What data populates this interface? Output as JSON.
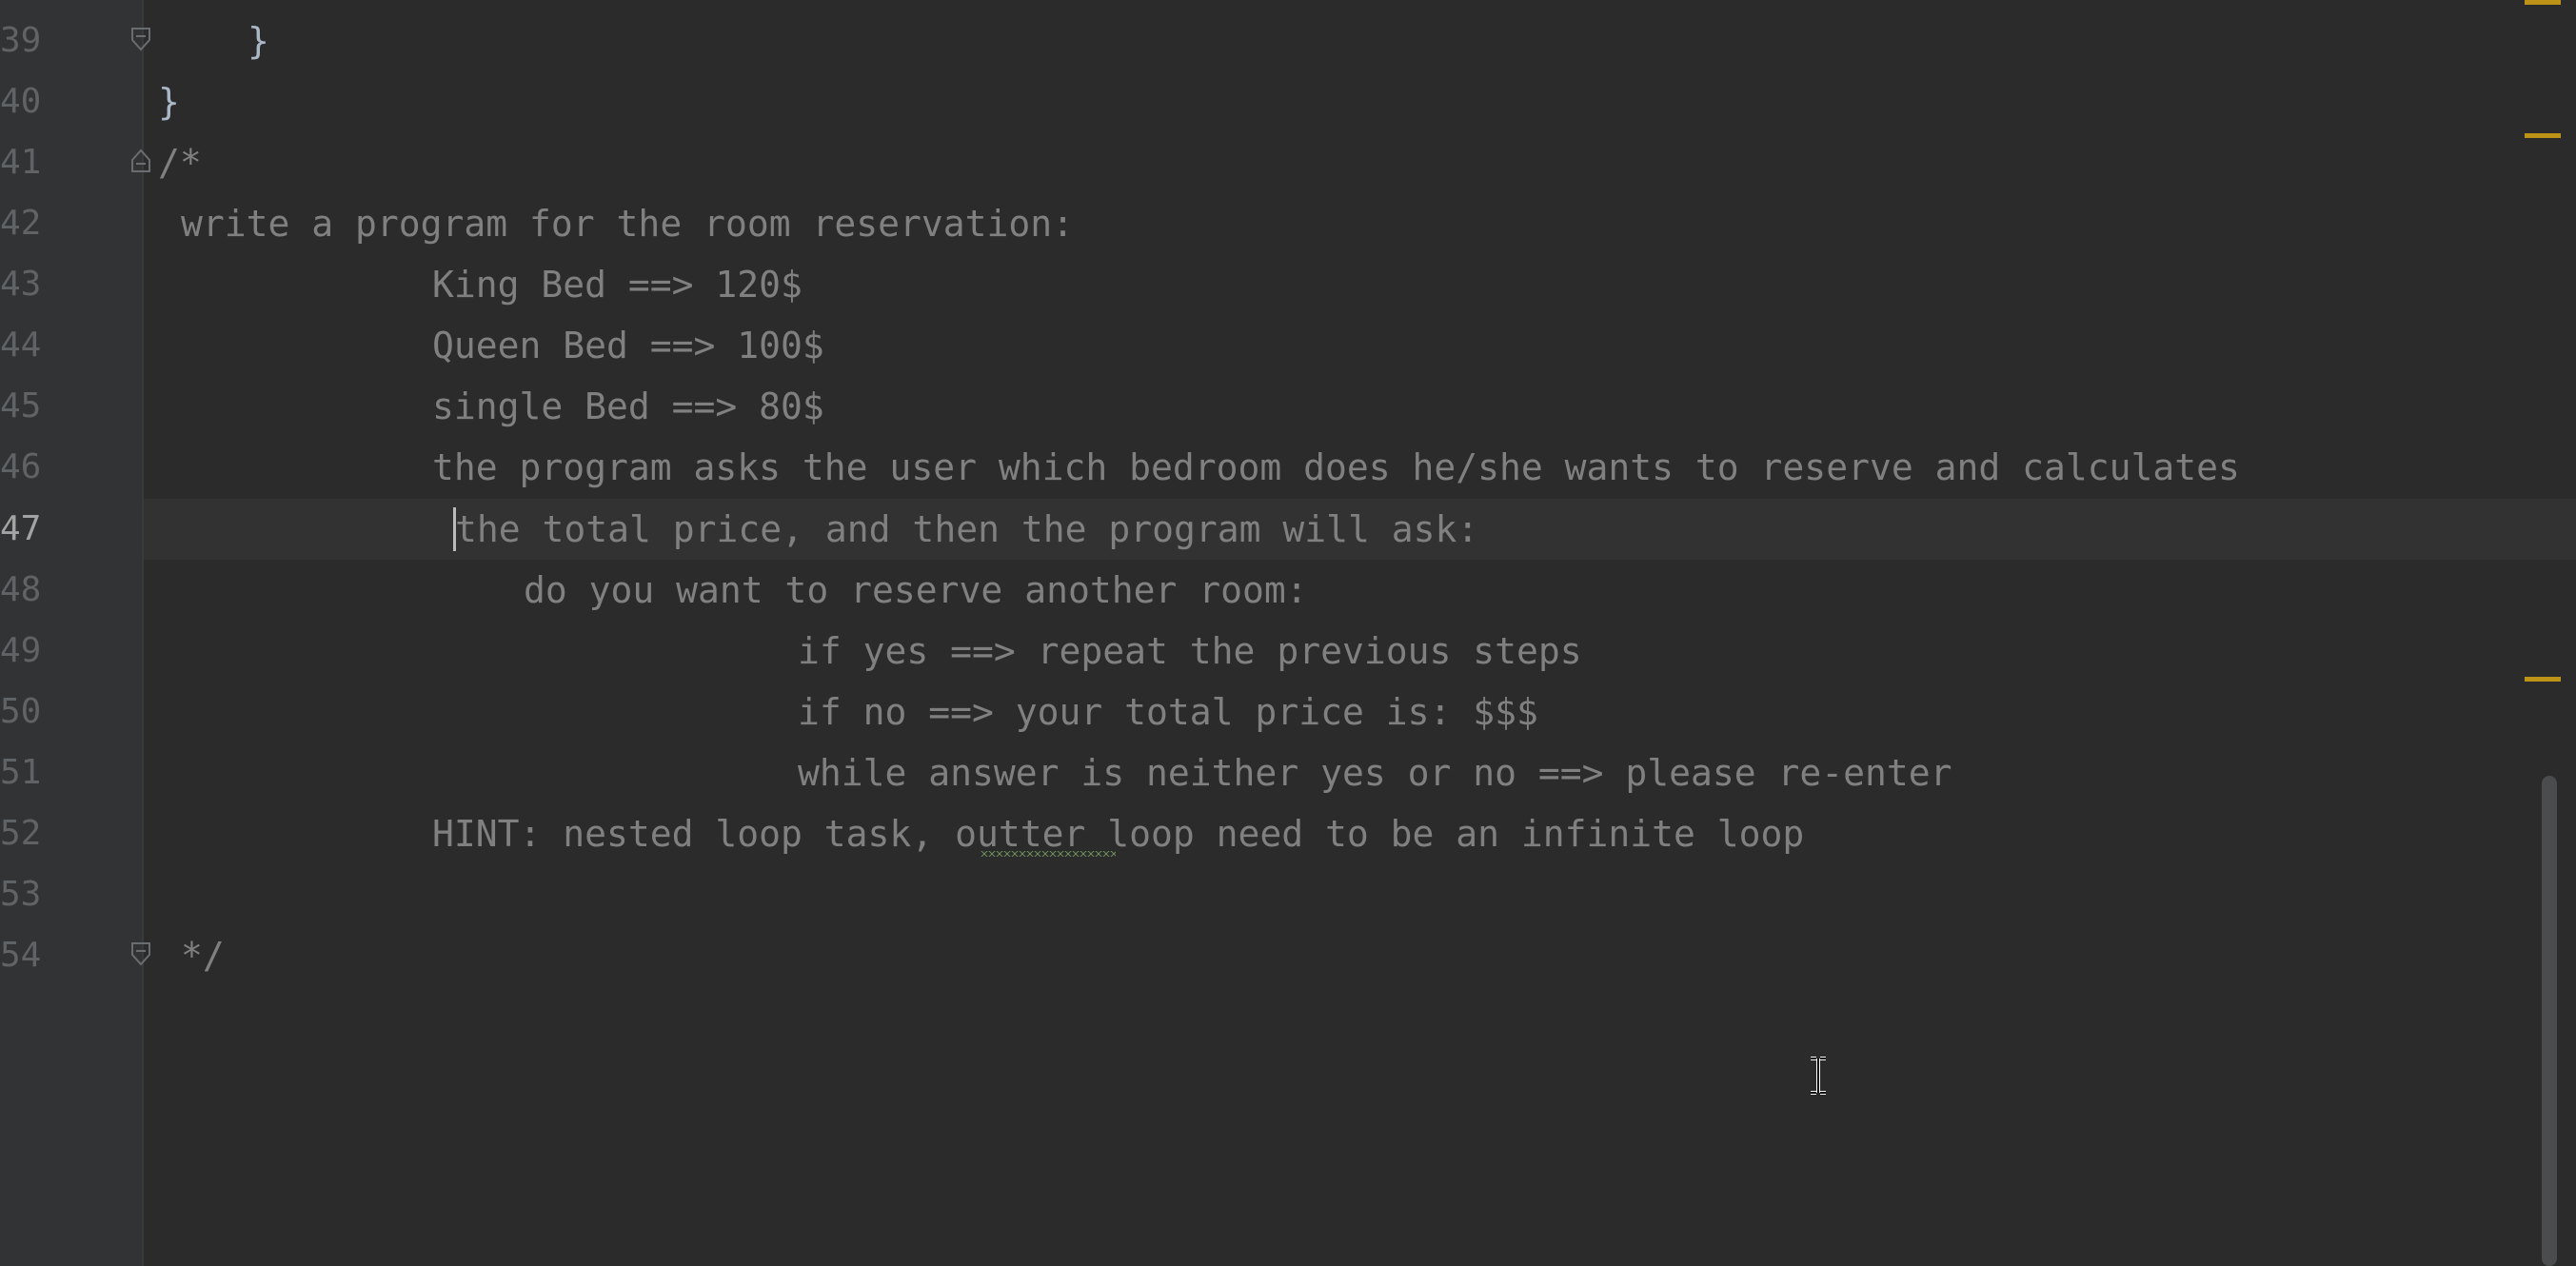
{
  "editor": {
    "current_line": "47",
    "lines": [
      {
        "num": "39",
        "text": "}"
      },
      {
        "num": "40",
        "text": "}"
      },
      {
        "num": "41",
        "text": "/*"
      },
      {
        "num": "42",
        "text": "write a program for the room reservation:"
      },
      {
        "num": "43",
        "text": "King Bed ==> 120$"
      },
      {
        "num": "44",
        "text": "Queen Bed ==> 100$"
      },
      {
        "num": "45",
        "text": "single Bed ==> 80$"
      },
      {
        "num": "46",
        "text": "the program asks the user which bedroom does he/she wants to reserve and calculates"
      },
      {
        "num": "47",
        "text": "the total price, and then the program will ask:"
      },
      {
        "num": "48",
        "text": "do you want to reserve another room:"
      },
      {
        "num": "49",
        "text": "if yes ==> repeat the previous steps"
      },
      {
        "num": "50",
        "text": "if no ==> your total price is: $$$"
      },
      {
        "num": "51",
        "text": "while answer is neither yes or no ==> please re-enter"
      },
      {
        "num": "52",
        "text": "HINT: nested loop task, outter loop need to be an infinite loop"
      },
      {
        "num": "53",
        "text": ""
      },
      {
        "num": "54",
        "text": "*/"
      }
    ]
  },
  "colors": {
    "background": "#2b2b2b",
    "gutter": "#313335",
    "comment": "#808080",
    "brace": "#a9b7c6",
    "current_line": "#323232",
    "warning_stripe": "#be9117",
    "typo_underline": "#6a8759"
  },
  "icons": {
    "fold": "fold-marker-icon",
    "cursor": "text-cursor-icon"
  }
}
